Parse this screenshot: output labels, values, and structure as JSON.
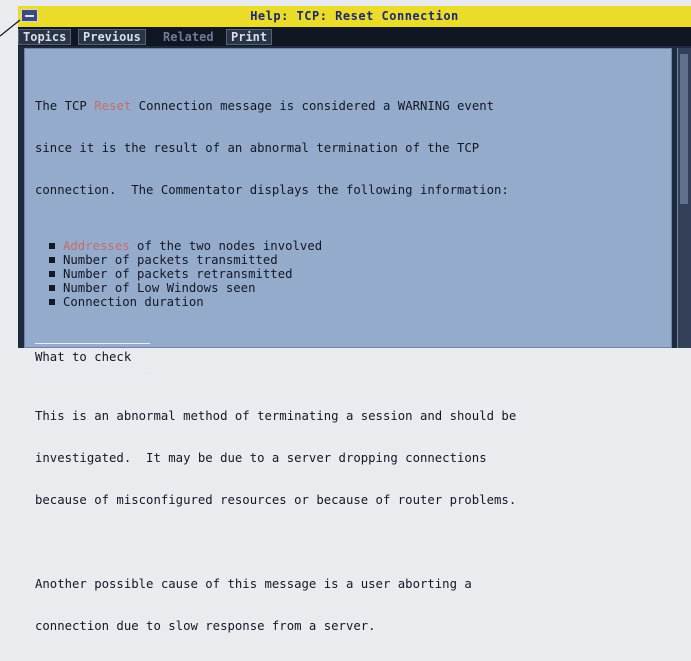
{
  "window": {
    "title": "Help: TCP: Reset Connection"
  },
  "menubar": {
    "topics": "Topics",
    "previous": "Previous",
    "related": "Related",
    "print": "Print"
  },
  "content": {
    "intro": {
      "line1_a": "The TCP ",
      "line1_hl": "Reset",
      "line1_b": " Connection message is considered a WARNING event",
      "line2": "since it is the result of an abnormal termination of the TCP",
      "line3": "connection.  The Commentator displays the following information:"
    },
    "bullets": {
      "b1_hl": "Addresses",
      "b1_rest": " of the two nodes involved",
      "b2": "Number of packets transmitted",
      "b3": "Number of packets retransmitted",
      "b4": "Number of Low Windows seen",
      "b5": "Connection duration"
    },
    "section_title": "What to check",
    "para2": {
      "line1": "This is an abnormal method of terminating a session and should be",
      "line2": "investigated.  It may be due to a server dropping connections",
      "line3": "because of misconfigured resources or because of router problems."
    },
    "para3": {
      "line1": "Another possible cause of this message is a user aborting a",
      "line2": "connection due to slow response from a server."
    }
  },
  "colors": {
    "titlebar_bg": "#ecdc2a",
    "titlebar_text": "#1c2a74",
    "content_bg": "#95abcb",
    "link_highlight": "#c56d6f"
  }
}
